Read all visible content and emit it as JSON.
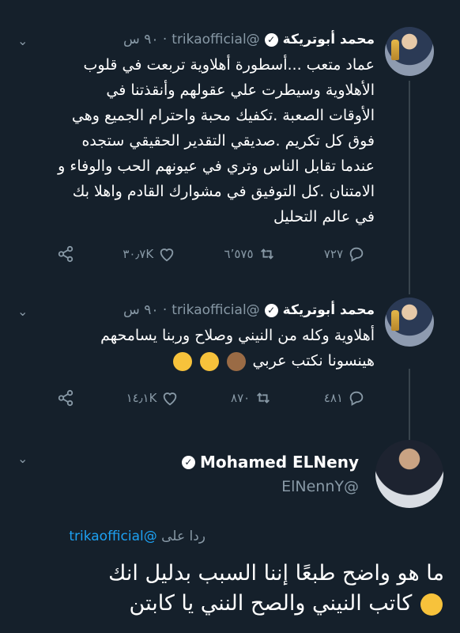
{
  "thread": [
    {
      "name": "محمد أبوتريكة",
      "handle": "@trikaofficial",
      "time": "٩٠ س",
      "lines": [
        "عماد متعب ...أسطورة أهلاوية تربعت في قلوب",
        "الأهلاوية وسيطرت علي عقولهم وأنقذتنا في",
        "الأوقات الصعبة .تكفيك محبة واحترام الجميع وهي",
        "فوق كل تكريم .صديقي التقدير الحقيقي ستجده",
        "عندما تقابل الناس وتري في عيونهم الحب والوفاء و",
        "الامتنان .كل التوفيق في مشوارك القادم واهلا بك",
        "في عالم التحليل"
      ],
      "replies": "٧٢٧",
      "retweets": "٦٬٥٧٥",
      "likes": "٣٠٫٧K"
    },
    {
      "name": "محمد أبوتريكة",
      "handle": "@trikaofficial",
      "time": "٩٠ س",
      "lines": [
        "أهلاوية  وكله من النيني وصلاح وربنا يسامحهم",
        "هينسونا نكتب عربي"
      ],
      "replies": "٤٨١",
      "retweets": "٨٧٠",
      "likes": "١٤٫١K"
    }
  ],
  "main": {
    "name": "Mohamed ELNeny",
    "handle": "@ElNennY",
    "reply_prefix": "ردا على",
    "reply_handle": "@trikaofficial",
    "lines": [
      "ما هو واضح طبعًا إننا السبب بدليل انك",
      "كاتب النيني والصح النني يا كابتن"
    ]
  },
  "icons": {
    "reply": "reply-icon",
    "retweet": "retweet-icon",
    "like": "heart-icon",
    "share": "share-icon",
    "more": "chevron-down-icon",
    "verified": "verified-badge-icon"
  },
  "colors": {
    "background": "#15202b",
    "secondary_text": "#8899a6",
    "link": "#1da1f2"
  }
}
